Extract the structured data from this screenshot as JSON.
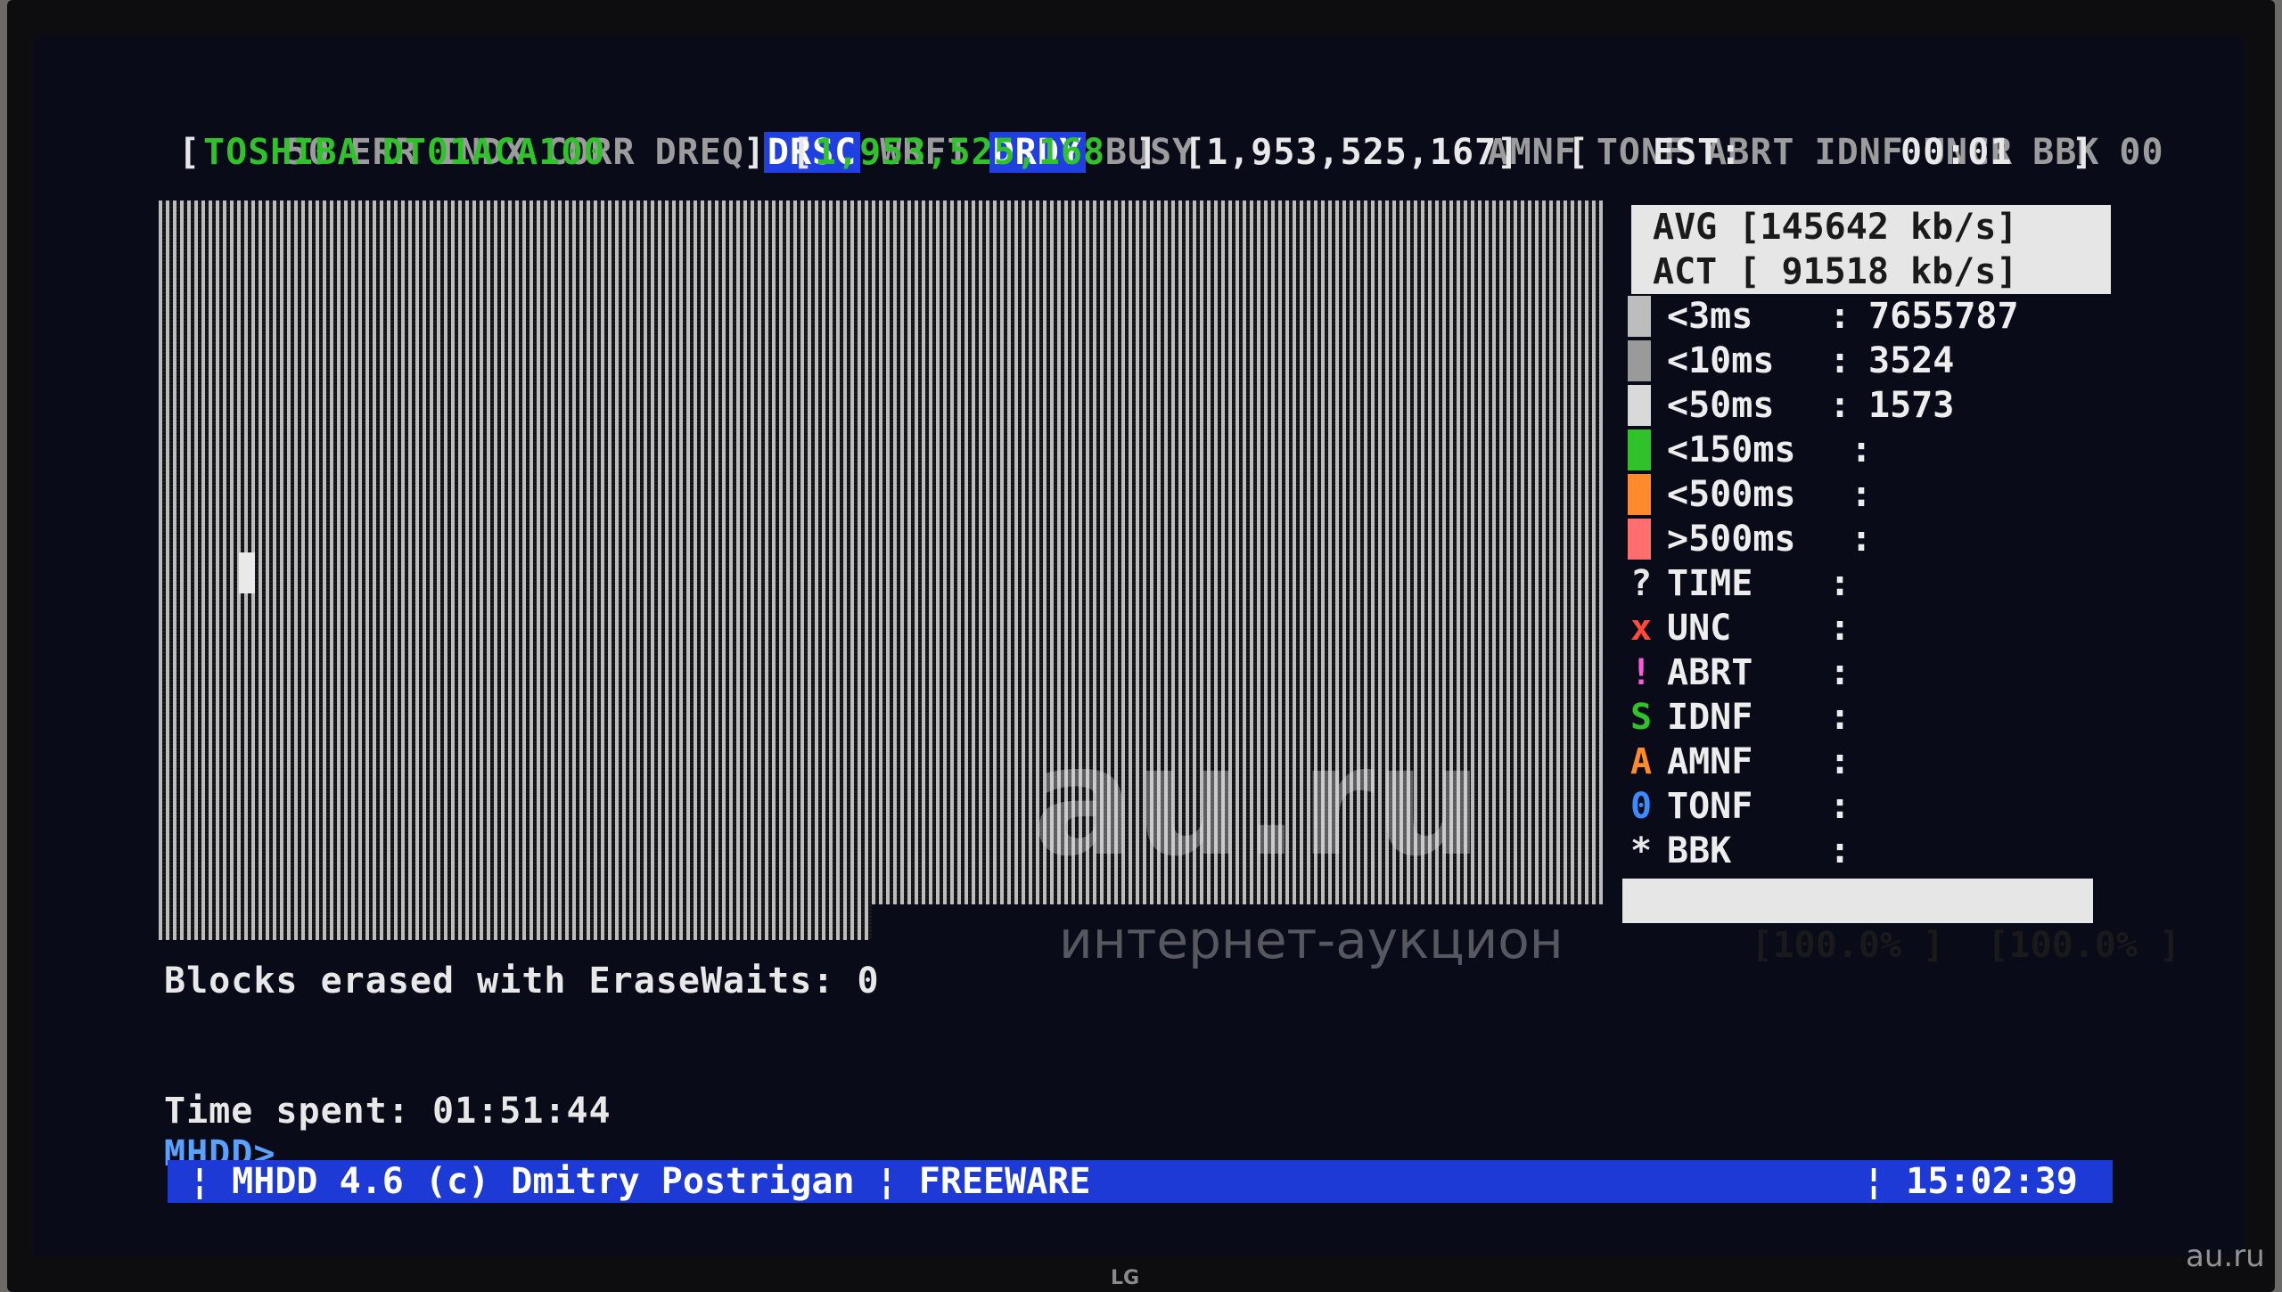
{
  "status_bits": {
    "left": [
      "50",
      "ERR",
      "INDX",
      "CORR",
      "DREQ",
      "DRSC",
      "WRFT",
      "DRDY",
      "BUSY"
    ],
    "right": [
      "AMNF",
      "TONF",
      "ABRT",
      "IDNF",
      "UNCR",
      "BBK",
      "00"
    ]
  },
  "drive": {
    "bracket_open": "[",
    "model": "TOSHIBA DT01ACA100",
    "bracket_close": "]",
    "lba_total_open": "[",
    "lba_total": "1,953,525,168",
    "lba_total_close": "]",
    "lba_current": "[1,953,525,167]",
    "est_open": "[",
    "est_label": "EST:",
    "est_value": "00:01",
    "est_close": "]"
  },
  "speed": {
    "avg": "AVG [145642 kb/s]",
    "act": "ACT [ 91518 kb/s]"
  },
  "timing_legend": [
    {
      "label": "<3ms",
      "sep": ":",
      "value": "7655787",
      "color": "#bdbdbd"
    },
    {
      "label": "<10ms",
      "sep": ":",
      "value": "3524",
      "color": "#9a9a9a"
    },
    {
      "label": "<50ms",
      "sep": ":",
      "value": "1573",
      "color": "#d9d9d9"
    },
    {
      "label": "<150ms",
      "sep": ":",
      "value": "",
      "color": "#2fc22a"
    },
    {
      "label": "<500ms",
      "sep": ":",
      "value": "",
      "color": "#ff8a2a"
    },
    {
      "label": ">500ms",
      "sep": ":",
      "value": "",
      "color": "#ff6f6f"
    }
  ],
  "error_legend": [
    {
      "symbol": "?",
      "label": "TIME",
      "sep": ":",
      "color": "#e8e8e8"
    },
    {
      "symbol": "x",
      "label": "UNC",
      "sep": ":",
      "color": "#ff4a3a"
    },
    {
      "symbol": "!",
      "label": "ABRT",
      "sep": ":",
      "color": "#ff5adf"
    },
    {
      "symbol": "S",
      "label": "IDNF",
      "sep": ":",
      "color": "#2fc22a"
    },
    {
      "symbol": "A",
      "label": "AMNF",
      "sep": ":",
      "color": "#ff8a2a"
    },
    {
      "symbol": "0",
      "label": "TONF",
      "sep": ":",
      "color": "#3a8bff"
    },
    {
      "symbol": "*",
      "label": "BBK",
      "sep": ":",
      "color": "#e8e8e8"
    }
  ],
  "progress": {
    "left": "[100.0% ]",
    "right": "[100.0% ]"
  },
  "console": {
    "erase_msg": "Blocks erased with EraseWaits: 0",
    "time_spent": "Time spent: 01:51:44",
    "prompt": "MHDD>",
    "cursor": "_"
  },
  "bottom_bar": {
    "left": "¦ MHDD 4.6 (c) Dmitry Postrigan ¦ FREEWARE",
    "right": "¦ 15:02:39"
  },
  "watermark": {
    "brand": "au.ru",
    "tagline": "интернет-аукцион",
    "corner": "au.ru"
  },
  "tv_logo": "LG"
}
